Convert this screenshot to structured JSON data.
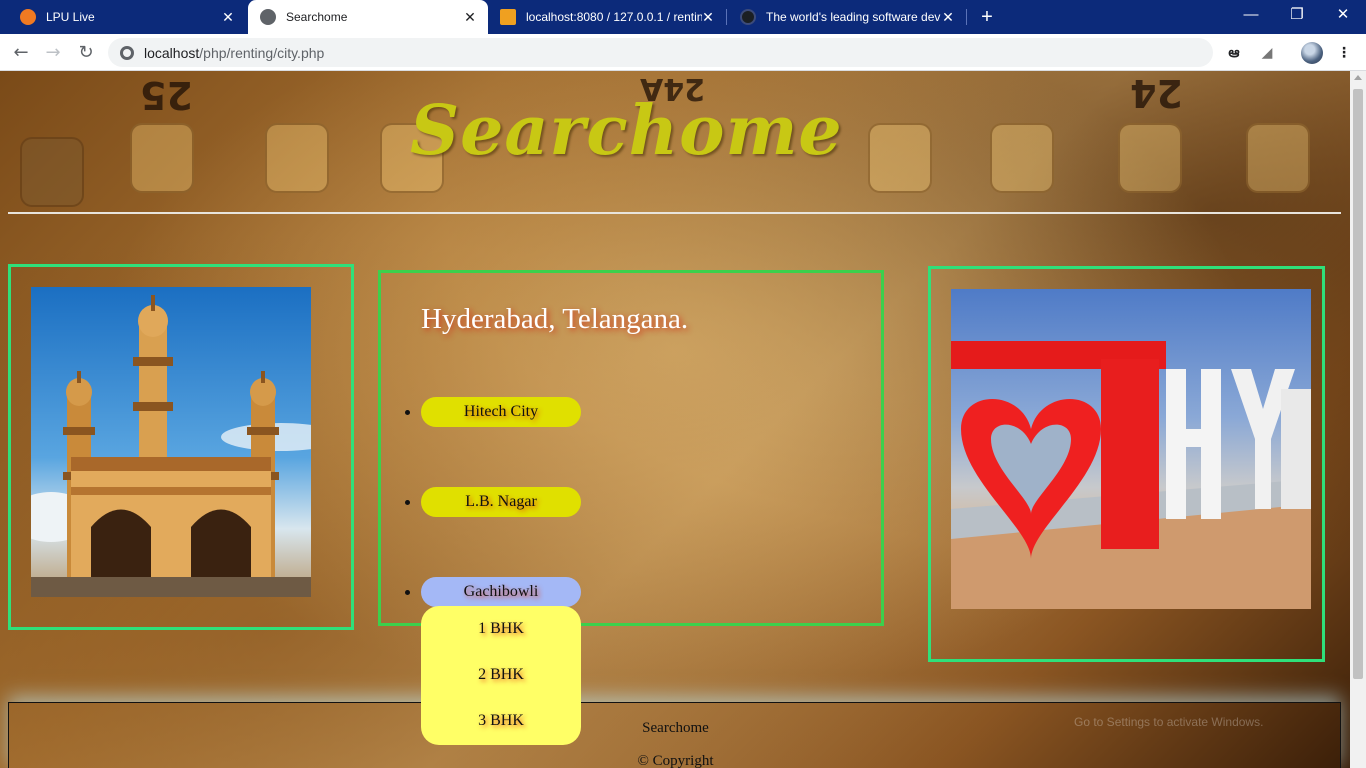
{
  "browser": {
    "tabs": [
      {
        "title": "LPU Live",
        "icon": "lpu-favicon-icon",
        "active": false
      },
      {
        "title": "Searchome",
        "icon": "globe-icon",
        "active": true
      },
      {
        "title": "localhost:8080 / 127.0.0.1 / rentin",
        "icon": "phpmyadmin-icon",
        "active": false
      },
      {
        "title": "The world's leading software dev",
        "icon": "github-icon",
        "active": false
      }
    ],
    "new_tab_icon": "plus-icon",
    "window_controls": [
      "minimize-icon",
      "restore-icon",
      "close-icon"
    ],
    "url_host": "localhost",
    "url_path": "/php/renting/city.php"
  },
  "header": {
    "logo": "Searchome",
    "film_numbers": [
      "25",
      "24A",
      "24"
    ]
  },
  "main": {
    "city_title": "Hyderabad, Telangana.",
    "areas": [
      {
        "label": "Hitech City"
      },
      {
        "label": "L.B. Nagar"
      },
      {
        "label": "Gachibowli"
      }
    ],
    "dropdown": [
      "1 BHK",
      "2 BHK",
      "3 BHK"
    ],
    "left_image": "charminar-image",
    "right_image": "love-hyd-sign-image"
  },
  "footer": {
    "brand": "Searchome",
    "copyright": "© Copyright"
  },
  "watermark": "Go to Settings to activate Windows."
}
